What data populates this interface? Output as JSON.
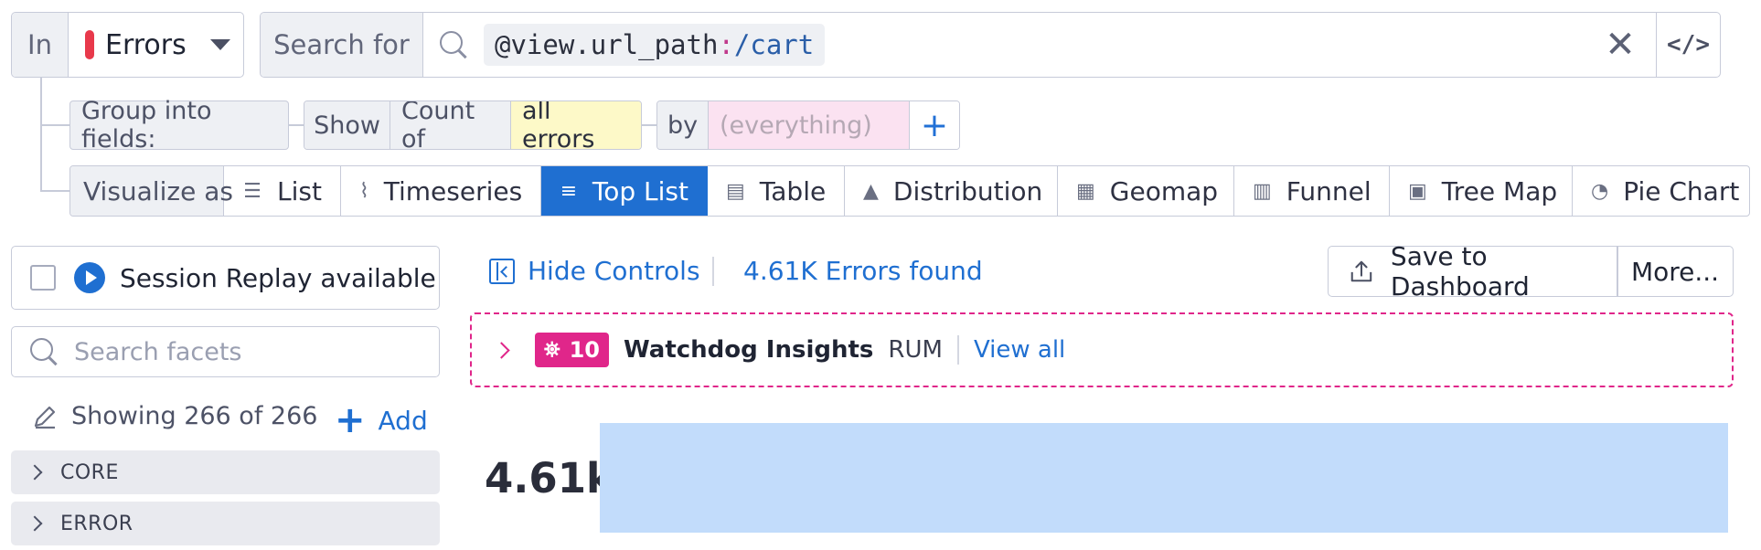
{
  "query": {
    "in_label": "In",
    "source_value": "Errors",
    "search_label": "Search for",
    "search_key": "@view.url_path",
    "search_colon": ":",
    "search_val": "/cart",
    "code_label": "</>"
  },
  "group": {
    "group_label": "Group into fields:",
    "show_label": "Show",
    "count_of_label": "Count of",
    "measure_value": "all errors",
    "by_label": "by",
    "by_placeholder": "(everything)",
    "add_symbol": "+"
  },
  "visualize": {
    "label": "Visualize as",
    "options": [
      {
        "label": "List",
        "icon": "list-icon"
      },
      {
        "label": "Timeseries",
        "icon": "timeseries-icon"
      },
      {
        "label": "Top List",
        "icon": "toplist-icon",
        "active": true
      },
      {
        "label": "Table",
        "icon": "table-icon"
      },
      {
        "label": "Distribution",
        "icon": "distribution-icon"
      },
      {
        "label": "Geomap",
        "icon": "geomap-icon"
      },
      {
        "label": "Funnel",
        "icon": "funnel-icon"
      },
      {
        "label": "Tree Map",
        "icon": "treemap-icon"
      },
      {
        "label": "Pie Chart",
        "icon": "piechart-icon"
      }
    ]
  },
  "sidebar": {
    "session_replay_label": "Session Replay available",
    "facet_search_placeholder": "Search facets",
    "showing_text": "Showing 266 of 266",
    "add_label": "Add",
    "sections": [
      {
        "label": "CORE"
      },
      {
        "label": "ERROR"
      }
    ]
  },
  "main": {
    "hide_controls_label": "Hide Controls",
    "found_text": "4.61K Errors found",
    "save_label": "Save to Dashboard",
    "more_label": "More...",
    "watchdog": {
      "count": "10",
      "title": "Watchdog Insights",
      "product": "RUM",
      "view_all_label": "View all"
    },
    "toplist": {
      "value_label": "4.61k",
      "fill_fraction": 1.0
    }
  },
  "colors": {
    "accent": "#1f6fd1",
    "error_red": "#e8394b",
    "watchdog_pink": "#e0268a",
    "bar_fill": "#c2dcfb"
  }
}
